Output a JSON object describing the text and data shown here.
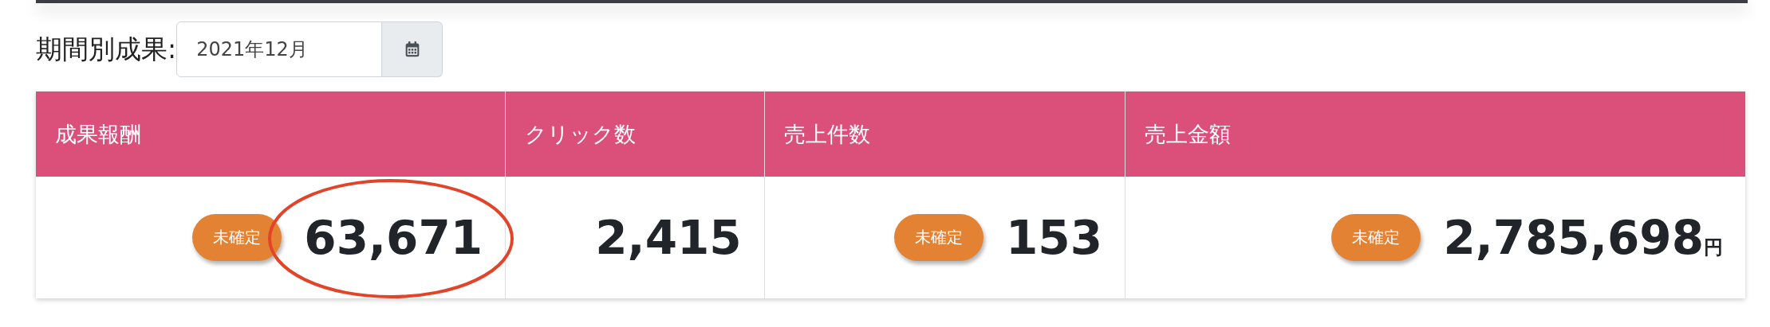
{
  "period": {
    "label": "期間別成果:",
    "value": "2021年12月"
  },
  "stats": [
    {
      "heading": "成果報酬",
      "status": "未確定",
      "value": "63,671",
      "circled": true
    },
    {
      "heading": "クリック数",
      "value": "2,415",
      "circled": false
    },
    {
      "heading": "売上件数",
      "status": "未確定",
      "value": "153",
      "circled": false
    },
    {
      "heading": "売上金額",
      "status": "未確定",
      "value": "2,785,698",
      "unit": "円",
      "circled": false
    }
  ]
}
